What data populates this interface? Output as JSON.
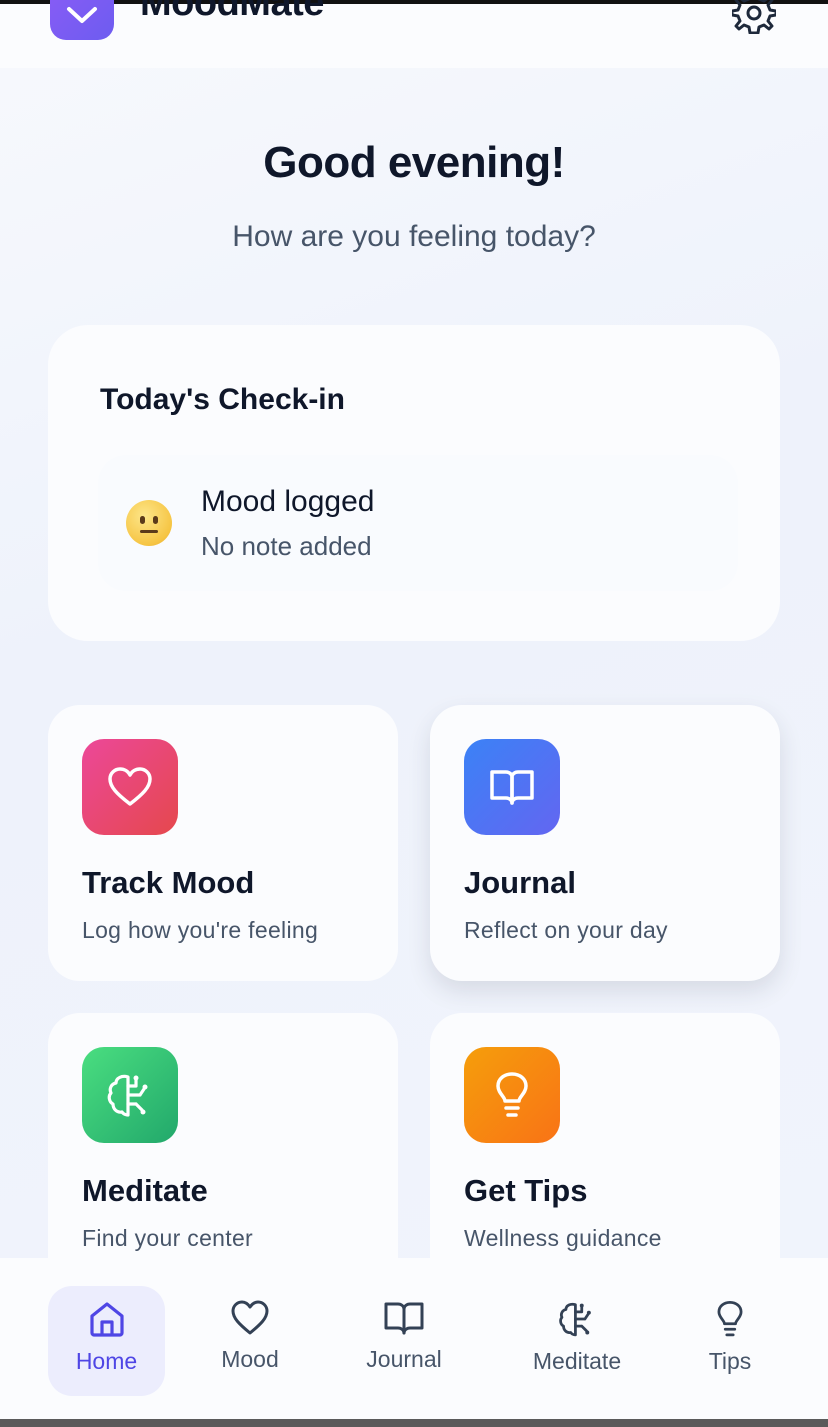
{
  "app": {
    "name": "MoodMate"
  },
  "greeting": {
    "title": "Good evening!",
    "subtitle": "How are you feeling today?"
  },
  "checkin": {
    "title": "Today's Check-in",
    "mood_status": "Mood logged",
    "mood_note": "No note added",
    "emoji_icon": "neutral-face-icon"
  },
  "actions": [
    {
      "title": "Track Mood",
      "description": "Log how you're feeling",
      "icon": "heart-icon",
      "color_from": "#ec4899",
      "color_to": "#e5484d"
    },
    {
      "title": "Journal",
      "description": "Reflect on your day",
      "icon": "book-open-icon",
      "color_from": "#3b82f6",
      "color_to": "#6366f1"
    },
    {
      "title": "Meditate",
      "description": "Find your center",
      "icon": "brain-icon",
      "color_from": "#4ade80",
      "color_to": "#22a86b"
    },
    {
      "title": "Get Tips",
      "description": "Wellness guidance",
      "icon": "lightbulb-icon",
      "color_from": "#f59e0b",
      "color_to": "#f97316"
    }
  ],
  "nav": [
    {
      "label": "Home",
      "icon": "home-icon",
      "active": true
    },
    {
      "label": "Mood",
      "icon": "heart-icon",
      "active": false
    },
    {
      "label": "Journal",
      "icon": "book-open-icon",
      "active": false
    },
    {
      "label": "Meditate",
      "icon": "brain-icon",
      "active": false
    },
    {
      "label": "Tips",
      "icon": "lightbulb-icon",
      "active": false
    }
  ],
  "colors": {
    "accent": "#4f46e5",
    "active_nav_bg": "#ecedfd",
    "text_primary": "#0f172a",
    "text_secondary": "#475569"
  }
}
